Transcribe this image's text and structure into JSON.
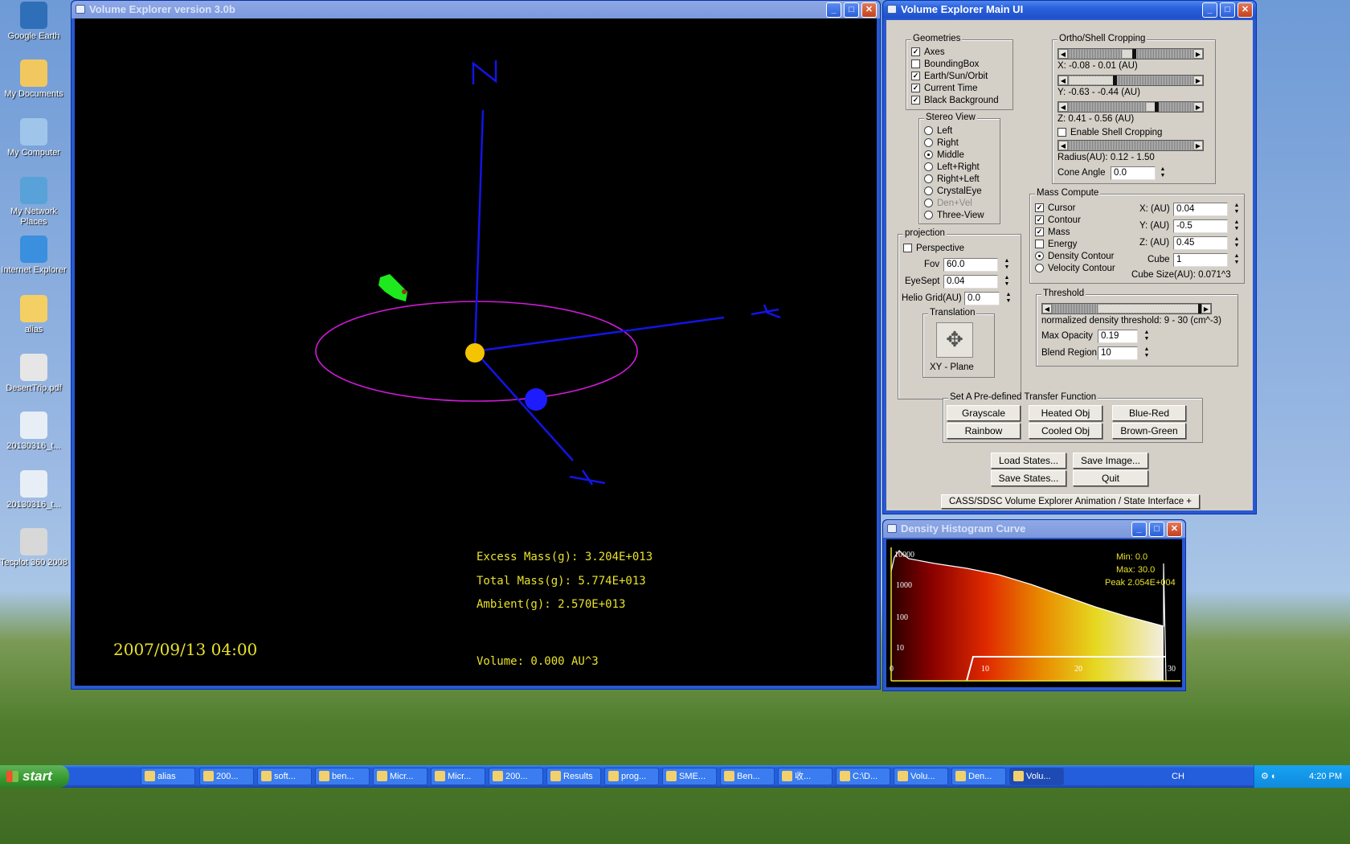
{
  "desktop": {
    "icons": [
      {
        "label": "Google Earth",
        "icon": "google-earth-icon",
        "color": "#2f6fb8"
      },
      {
        "label": "My Documents",
        "icon": "my-documents-icon",
        "color": "#f1c860"
      },
      {
        "label": "My Computer",
        "icon": "my-computer-icon",
        "color": "#9fc5ea"
      },
      {
        "label": "My Network Places",
        "icon": "network-places-icon",
        "color": "#58a2d9"
      },
      {
        "label": "Internet Explorer",
        "icon": "internet-explorer-icon",
        "color": "#3a8fde"
      },
      {
        "label": "alias",
        "icon": "folder-icon",
        "color": "#f4cf63"
      },
      {
        "label": "DesertTrip.pdf",
        "icon": "pdf-icon",
        "color": "#e6e6e6"
      },
      {
        "label": "20130316_t...",
        "icon": "image-file-icon",
        "color": "#e8eef6"
      },
      {
        "label": "20130316_t...",
        "icon": "image-file-icon",
        "color": "#e8eef6"
      },
      {
        "label": "Tecplot 360 2008",
        "icon": "tecplot-icon",
        "color": "#d8d8d8"
      }
    ]
  },
  "viewer": {
    "title": "Volume Explorer version 3.0b",
    "excess_mass": "Excess Mass(g): 3.204E+013",
    "total_mass": "Total Mass(g): 5.774E+013",
    "ambient": "Ambient(g): 2.570E+013",
    "volume": "Volume: 0.000 AU^3",
    "datetime": "2007/09/13 04:00",
    "colors": {
      "axis": "#1414e6",
      "orbit": "#d01ad8",
      "sun": "#f5c400",
      "earth": "#1c1cff",
      "cme": "#1ee81e",
      "text": "#e8e22a"
    }
  },
  "mainui": {
    "title": "Volume Explorer Main UI",
    "geometries": {
      "title": "Geometries",
      "items": [
        {
          "label": "Axes",
          "checked": true
        },
        {
          "label": "BoundingBox",
          "checked": false
        },
        {
          "label": "Earth/Sun/Orbit",
          "checked": true
        },
        {
          "label": "Current Time",
          "checked": true
        },
        {
          "label": "Black Background",
          "checked": true
        }
      ]
    },
    "stereo": {
      "title": "Stereo View",
      "items": [
        {
          "label": "Left",
          "selected": false,
          "disabled": false
        },
        {
          "label": "Right",
          "selected": false,
          "disabled": false
        },
        {
          "label": "Middle",
          "selected": true,
          "disabled": false
        },
        {
          "label": "Left+Right",
          "selected": false,
          "disabled": false
        },
        {
          "label": "Right+Left",
          "selected": false,
          "disabled": false
        },
        {
          "label": "CrystalEye",
          "selected": false,
          "disabled": false
        },
        {
          "label": "Den+Vel",
          "selected": false,
          "disabled": true
        },
        {
          "label": "Three-View",
          "selected": false,
          "disabled": false
        }
      ]
    },
    "cropping": {
      "title": "Ortho/Shell Cropping",
      "x_label": "X: -0.08 - 0.01 (AU)",
      "y_label": "Y: -0.63 - -0.44 (AU)",
      "z_label": "Z: 0.41 - 0.56 (AU)",
      "enable_shell": "Enable Shell Cropping",
      "enable_shell_checked": false,
      "radius_label": "Radius(AU): 0.12 - 1.50",
      "cone_angle_label": "Cone Angle",
      "cone_angle_value": "0.0"
    },
    "projection": {
      "title": "projection",
      "perspective": "Perspective",
      "perspective_checked": false,
      "fov_label": "Fov",
      "fov_value": "60.0",
      "eyesept_label": "EyeSept",
      "eyesept_value": "0.04",
      "helio_label": "Helio Grid(AU)",
      "helio_value": "0.0",
      "translation_title": "Translation",
      "translation_plane": "XY - Plane"
    },
    "mass_compute": {
      "title": "Mass Compute",
      "checks": [
        {
          "label": "Cursor",
          "checked": true
        },
        {
          "label": "Contour",
          "checked": true
        },
        {
          "label": "Mass",
          "checked": true
        },
        {
          "label": "Energy",
          "checked": false
        }
      ],
      "radios": [
        {
          "label": "Density Contour",
          "selected": true
        },
        {
          "label": "Velocity Contour",
          "selected": false
        }
      ],
      "x_label": "X: (AU)",
      "x_value": "0.04",
      "y_label": "Y: (AU)",
      "y_value": "-0.5",
      "z_label": "Z: (AU)",
      "z_value": "0.45",
      "cube_label": "Cube",
      "cube_value": "1",
      "cube_size": "Cube Size(AU): 0.071^3"
    },
    "threshold": {
      "title": "Threshold",
      "density_label": "normalized density threshold: 9 - 30 (cm^-3)",
      "opacity_label": "Max Opacity",
      "opacity_value": "0.19",
      "blend_label": "Blend Region",
      "blend_value": "10"
    },
    "transfer": {
      "title": "Set A Pre-defined Transfer Function",
      "buttons": [
        "Grayscale",
        "Heated Obj",
        "Blue-Red",
        "Rainbow",
        "Cooled Obj",
        "Brown-Green"
      ]
    },
    "actions": {
      "load": "Load States...",
      "save_image": "Save Image...",
      "save_states": "Save States...",
      "quit": "Quit"
    },
    "footer": "CASS/SDSC Volume Explorer Animation / State Interface +"
  },
  "histogram": {
    "title": "Density Histogram Curve",
    "min": "Min: 0.0",
    "max": "Max: 30.0",
    "peak": "Peak 2.054E+004",
    "y_ticks": [
      "10000",
      "1000",
      "100",
      "10"
    ],
    "x_ticks": [
      "0",
      "10",
      "20",
      "30"
    ]
  },
  "taskbar": {
    "start": "start",
    "tasks": [
      "alias",
      "200...",
      "soft...",
      "ben...",
      "Micr...",
      "Micr...",
      "200...",
      "Results",
      "prog...",
      "SME...",
      "Ben...",
      "收...",
      "C:\\D...",
      "Volu...",
      "Den...",
      "Volu..."
    ],
    "lang": "CH",
    "time": "4:20 PM"
  }
}
